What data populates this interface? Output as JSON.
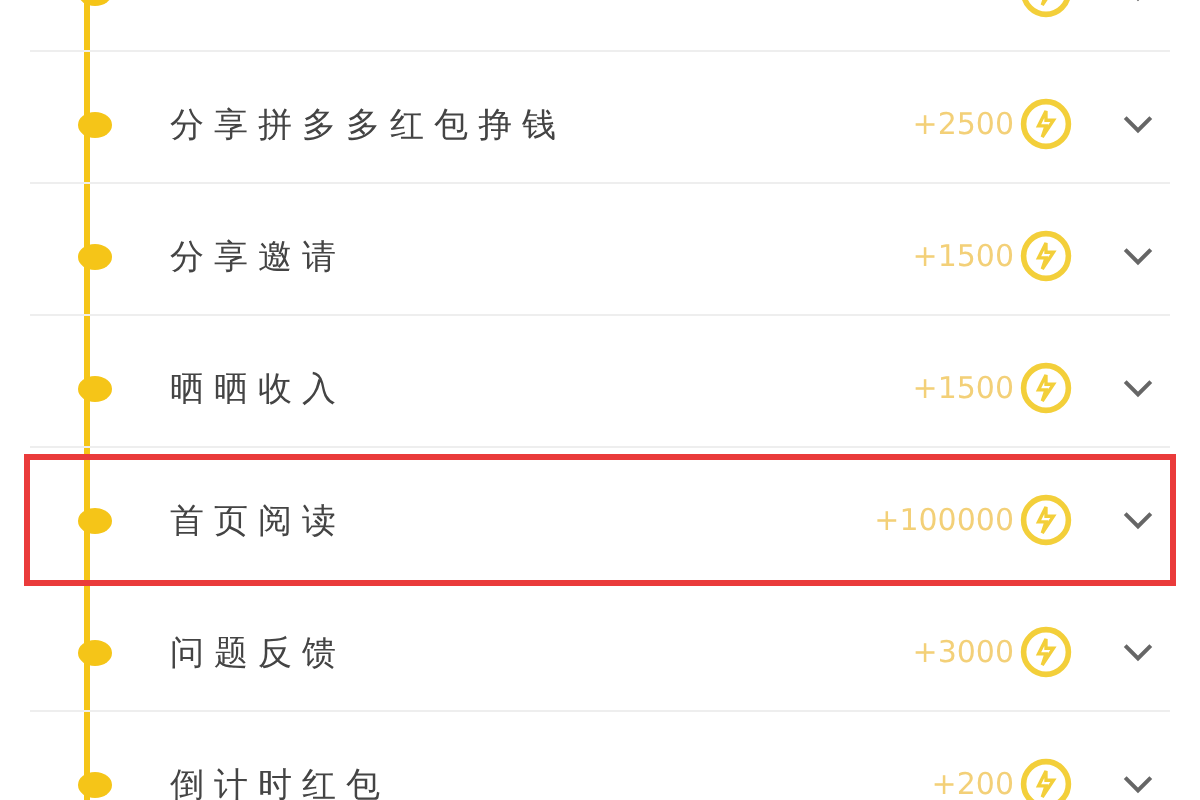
{
  "tasks": [
    {
      "title": "分享拼多多红包挣钱",
      "reward": "+2500",
      "selected": false
    },
    {
      "title": "分享邀请",
      "reward": "+1500",
      "selected": false
    },
    {
      "title": "晒晒收入",
      "reward": "+1500",
      "selected": false
    },
    {
      "title": "首页阅读",
      "reward": "+100000",
      "selected": true
    },
    {
      "title": "问题反馈",
      "reward": "+3000",
      "selected": false
    },
    {
      "title": "倒计时红包",
      "reward": "+200",
      "selected": false
    }
  ]
}
